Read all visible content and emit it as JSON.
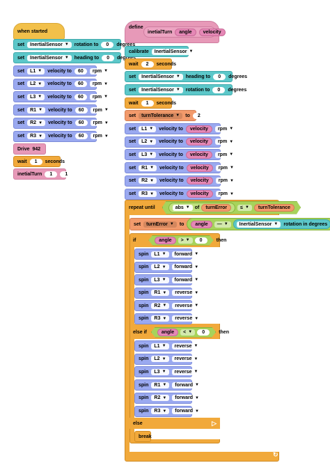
{
  "left_script": {
    "hat": "when started",
    "set_heading_rot": {
      "set": "set",
      "sensor": "InertialSensor",
      "prop": "rotation to",
      "value": "0",
      "unit": "degrees"
    },
    "set_heading": {
      "set": "set",
      "sensor": "InertialSensor",
      "prop": "heading to",
      "value": "0",
      "unit": "degrees"
    },
    "motors": [
      {
        "set": "set",
        "motor": "L1",
        "label": "velocity to",
        "value": "60",
        "unit": "rpm"
      },
      {
        "set": "set",
        "motor": "L2",
        "label": "velocity to",
        "value": "60",
        "unit": "rpm"
      },
      {
        "set": "set",
        "motor": "L3",
        "label": "velocity to",
        "value": "60",
        "unit": "rpm"
      },
      {
        "set": "set",
        "motor": "R1",
        "label": "velocity to",
        "value": "60",
        "unit": "rpm"
      },
      {
        "set": "set",
        "motor": "R2",
        "label": "velocity to",
        "value": "60",
        "unit": "rpm"
      },
      {
        "set": "set",
        "motor": "R3",
        "label": "velocity to",
        "value": "60",
        "unit": "rpm"
      }
    ],
    "drive": {
      "label": "Drive",
      "value": "942"
    },
    "wait": {
      "label": "wait",
      "value": "1",
      "unit": "seconds"
    },
    "call": {
      "label": "inetialTurn",
      "a": "1",
      "b": "1"
    }
  },
  "define": {
    "label": "define",
    "name": "inetialTurn",
    "param1": "angle",
    "param2": "velocity",
    "calibrate": {
      "label": "calibrate",
      "sensor": "InertialSensor"
    },
    "wait1": {
      "label": "wait",
      "value": "2",
      "unit": "seconds"
    },
    "set_heading": {
      "set": "set",
      "sensor": "InertialSensor",
      "prop": "heading to",
      "value": "0",
      "unit": "degrees"
    },
    "set_rotation": {
      "set": "set",
      "sensor": "InertialSensor",
      "prop": "rotation to",
      "value": "0",
      "unit": "degrees"
    },
    "wait2": {
      "label": "wait",
      "value": "1",
      "unit": "seconds"
    },
    "set_tol": {
      "set": "set",
      "var": "turnTolerance",
      "to": "to",
      "value": "2"
    },
    "motors": [
      {
        "set": "set",
        "motor": "L1",
        "label": "velocity to",
        "value": "velocity",
        "unit": "rpm"
      },
      {
        "set": "set",
        "motor": "L2",
        "label": "velocity to",
        "value": "velocity",
        "unit": "rpm"
      },
      {
        "set": "set",
        "motor": "L3",
        "label": "velocity to",
        "value": "velocity",
        "unit": "rpm"
      },
      {
        "set": "set",
        "motor": "R1",
        "label": "velocity to",
        "value": "velocity",
        "unit": "rpm"
      },
      {
        "set": "set",
        "motor": "R2",
        "label": "velocity to",
        "value": "velocity",
        "unit": "rpm"
      },
      {
        "set": "set",
        "motor": "R3",
        "label": "velocity to",
        "value": "velocity",
        "unit": "rpm"
      }
    ],
    "repeat": {
      "label": "repeat until",
      "fn": "abs",
      "of": "of",
      "var": "turnError",
      "cmp": "≤",
      "rhs": "turnTolerance"
    },
    "set_err": {
      "set": "set",
      "var": "turnError",
      "to": "to",
      "lhs": "angle",
      "op": "—",
      "sensor": "InertialSensor",
      "prop": "rotation in degrees"
    },
    "if": {
      "label": "if",
      "lhs": "angle",
      "cmp": ">",
      "rhs": "0",
      "then": "then"
    },
    "if_spins": [
      {
        "label": "spin",
        "motor": "L1",
        "dir": "forward"
      },
      {
        "label": "spin",
        "motor": "L2",
        "dir": "forward"
      },
      {
        "label": "spin",
        "motor": "L3",
        "dir": "forward"
      },
      {
        "label": "spin",
        "motor": "R1",
        "dir": "reverse"
      },
      {
        "label": "spin",
        "motor": "R2",
        "dir": "reverse"
      },
      {
        "label": "spin",
        "motor": "R3",
        "dir": "reverse"
      }
    ],
    "elseif": {
      "label": "else if",
      "lhs": "angle",
      "cmp": "<",
      "rhs": "0",
      "then": "then"
    },
    "elseif_spins": [
      {
        "label": "spin",
        "motor": "L1",
        "dir": "reverse"
      },
      {
        "label": "spin",
        "motor": "L2",
        "dir": "reverse"
      },
      {
        "label": "spin",
        "motor": "L3",
        "dir": "reverse"
      },
      {
        "label": "spin",
        "motor": "R1",
        "dir": "forward"
      },
      {
        "label": "spin",
        "motor": "R2",
        "dir": "forward"
      },
      {
        "label": "spin",
        "motor": "R3",
        "dir": "forward"
      }
    ],
    "else": {
      "label": "else"
    },
    "break": {
      "label": "break"
    }
  }
}
